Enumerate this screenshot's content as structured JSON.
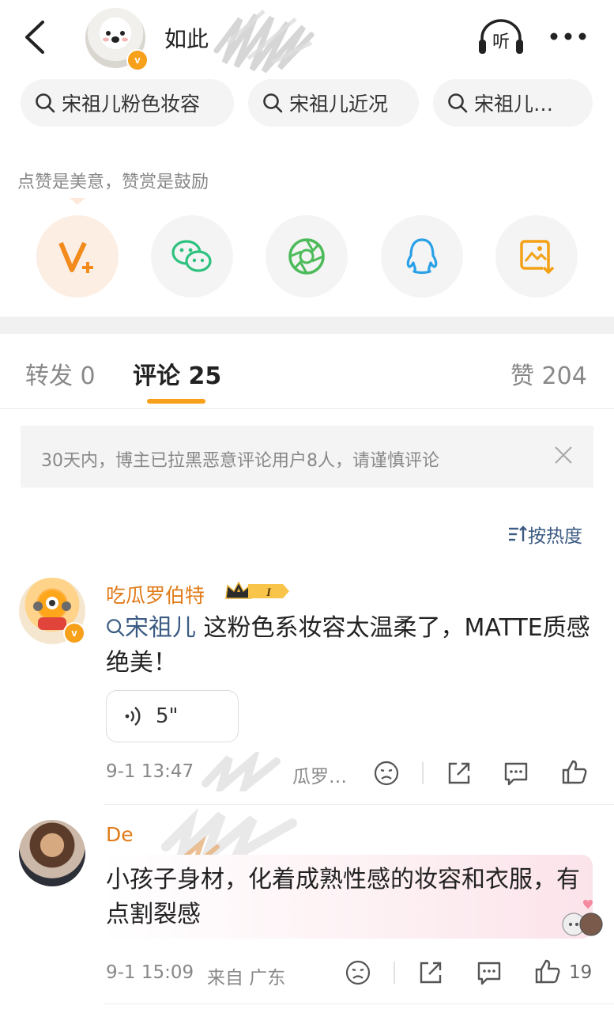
{
  "header": {
    "back_icon": "chevron-left-icon",
    "name": "如此",
    "listen_label": "听",
    "more_icon": "more-dots-icon"
  },
  "search_chips": [
    {
      "label": "宋祖儿粉色妆容"
    },
    {
      "label": "宋祖儿近况"
    },
    {
      "label": "宋祖儿…"
    }
  ],
  "reward": {
    "tip": "点赞是美意，赞赏是鼓励",
    "share_icons": [
      "vplus-icon",
      "wechat-icon",
      "moments-icon",
      "qq-icon",
      "save-image-icon"
    ]
  },
  "tabs": {
    "repost": "转发 0",
    "comments": "评论 25",
    "likes": "赞 204"
  },
  "notice": {
    "text": "30天内，博主已拉黑恶意评论用户8人，请谨慎评论"
  },
  "sort": {
    "label": "按热度"
  },
  "comments": [
    {
      "name": "吃瓜罗伯特",
      "level": "I",
      "tag": "宋祖儿",
      "text": "这粉色系妆容太温柔了，MATTE质感绝美！",
      "voice": "5\"",
      "date": "9-1 13:47",
      "meta_rest": "瓜罗…"
    },
    {
      "name": "De",
      "text": "小孩子身材，化着成熟性感的妆容和衣服，有点割裂感",
      "date": "9-1 15:09",
      "location": "来自 广东",
      "likes": "19"
    }
  ],
  "colors": {
    "accent_orange": "#f7a019",
    "link_blue": "#3b5b83",
    "wechat_green": "#2ec27e",
    "moments_green": "#4cbb5a",
    "qq_blue": "#2aa0e6",
    "save_orange": "#f4a116"
  }
}
